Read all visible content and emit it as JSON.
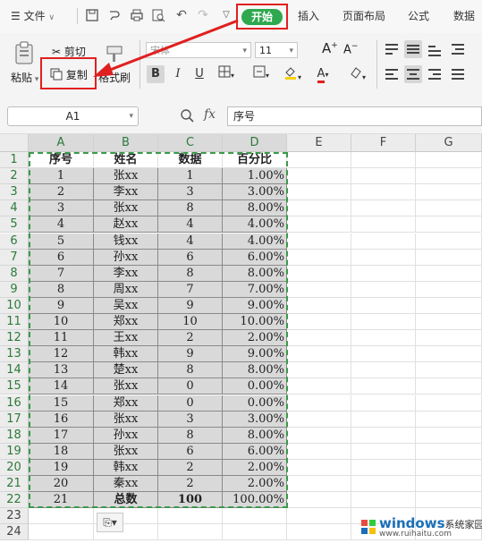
{
  "menubar": {
    "menu_icon": "hamburger-icon",
    "file_label": "文件",
    "start_label": "开始",
    "tabs": [
      "插入",
      "页面布局",
      "公式",
      "数据"
    ]
  },
  "ribbon": {
    "paste_label": "粘贴",
    "cut_label": "剪切",
    "copy_label": "复制",
    "format_painter_label": "格式刷",
    "font_name": "宋体",
    "font_size": "11",
    "bold": "B",
    "italic": "I",
    "underline": "U"
  },
  "formula_bar": {
    "cell_ref": "A1",
    "fx_label": "fx",
    "formula_value": "序号"
  },
  "sheet": {
    "columns": [
      "A",
      "B",
      "C",
      "D",
      "E",
      "F",
      "G"
    ],
    "rows": [
      {
        "n": "1",
        "a": "序号",
        "b": "姓名",
        "c": "数据",
        "d": "百分比"
      },
      {
        "n": "2",
        "a": "1",
        "b": "张xx",
        "c": "1",
        "d": "1.00%"
      },
      {
        "n": "3",
        "a": "2",
        "b": "李xx",
        "c": "3",
        "d": "3.00%"
      },
      {
        "n": "4",
        "a": "3",
        "b": "张xx",
        "c": "8",
        "d": "8.00%"
      },
      {
        "n": "5",
        "a": "4",
        "b": "赵xx",
        "c": "4",
        "d": "4.00%"
      },
      {
        "n": "6",
        "a": "5",
        "b": "钱xx",
        "c": "4",
        "d": "4.00%"
      },
      {
        "n": "7",
        "a": "6",
        "b": "孙xx",
        "c": "6",
        "d": "6.00%"
      },
      {
        "n": "8",
        "a": "7",
        "b": "李xx",
        "c": "8",
        "d": "8.00%"
      },
      {
        "n": "9",
        "a": "8",
        "b": "周xx",
        "c": "7",
        "d": "7.00%"
      },
      {
        "n": "10",
        "a": "9",
        "b": "吴xx",
        "c": "9",
        "d": "9.00%"
      },
      {
        "n": "11",
        "a": "10",
        "b": "郑xx",
        "c": "10",
        "d": "10.00%"
      },
      {
        "n": "12",
        "a": "11",
        "b": "王xx",
        "c": "2",
        "d": "2.00%"
      },
      {
        "n": "13",
        "a": "12",
        "b": "韩xx",
        "c": "9",
        "d": "9.00%"
      },
      {
        "n": "14",
        "a": "13",
        "b": "楚xx",
        "c": "8",
        "d": "8.00%"
      },
      {
        "n": "15",
        "a": "14",
        "b": "张xx",
        "c": "0",
        "d": "0.00%"
      },
      {
        "n": "16",
        "a": "15",
        "b": "郑xx",
        "c": "0",
        "d": "0.00%"
      },
      {
        "n": "17",
        "a": "16",
        "b": "张xx",
        "c": "3",
        "d": "3.00%"
      },
      {
        "n": "18",
        "a": "17",
        "b": "孙xx",
        "c": "8",
        "d": "8.00%"
      },
      {
        "n": "19",
        "a": "18",
        "b": "张xx",
        "c": "6",
        "d": "6.00%"
      },
      {
        "n": "20",
        "a": "19",
        "b": "韩xx",
        "c": "2",
        "d": "2.00%"
      },
      {
        "n": "21",
        "a": "20",
        "b": "秦xx",
        "c": "2",
        "d": "2.00%"
      },
      {
        "n": "22",
        "a": "21",
        "b": "总数",
        "c": "100",
        "d": "100.00%"
      }
    ],
    "extra_rows": [
      "23",
      "24"
    ]
  },
  "watermark": {
    "brand": "windows",
    "brand_suffix": "系统家园",
    "url": "www.ruihaitu.com"
  },
  "colors": {
    "start_green": "#2fa84f",
    "highlight_red": "#e02020",
    "marquee_green": "#3a9a4a"
  }
}
